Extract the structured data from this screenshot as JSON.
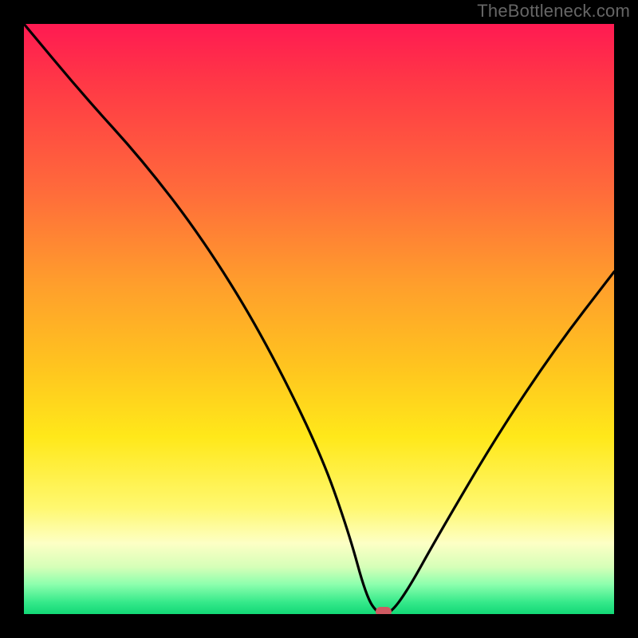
{
  "watermark": "TheBottleneck.com",
  "colors": {
    "frame": "#000000",
    "watermark_text": "#666666",
    "gradient_top": "#ff1a52",
    "gradient_mid": "#ffe81a",
    "gradient_bottom": "#12d876",
    "curve_stroke": "#000000",
    "marker_fill": "#cf5a62"
  },
  "chart_data": {
    "type": "line",
    "title": "",
    "xlabel": "",
    "ylabel": "",
    "x_range": [
      0,
      100
    ],
    "y_range": [
      0,
      100
    ],
    "series": [
      {
        "name": "bottleneck-curve",
        "x": [
          0,
          10,
          20,
          30,
          40,
          50,
          55,
          58,
          60,
          62,
          65,
          70,
          80,
          90,
          100
        ],
        "y": [
          100,
          88,
          77,
          64,
          48,
          28,
          14,
          3,
          0,
          0,
          4,
          13,
          30,
          45,
          58
        ]
      }
    ],
    "marker": {
      "x": 61,
      "y": 0
    },
    "background_gradient": {
      "orientation": "vertical",
      "stops": [
        {
          "pos": 0.0,
          "color": "#ff1a52"
        },
        {
          "pos": 0.28,
          "color": "#ff6a3b"
        },
        {
          "pos": 0.58,
          "color": "#ffc41f"
        },
        {
          "pos": 0.82,
          "color": "#fff870"
        },
        {
          "pos": 0.95,
          "color": "#8cffad"
        },
        {
          "pos": 1.0,
          "color": "#12d876"
        }
      ]
    }
  }
}
